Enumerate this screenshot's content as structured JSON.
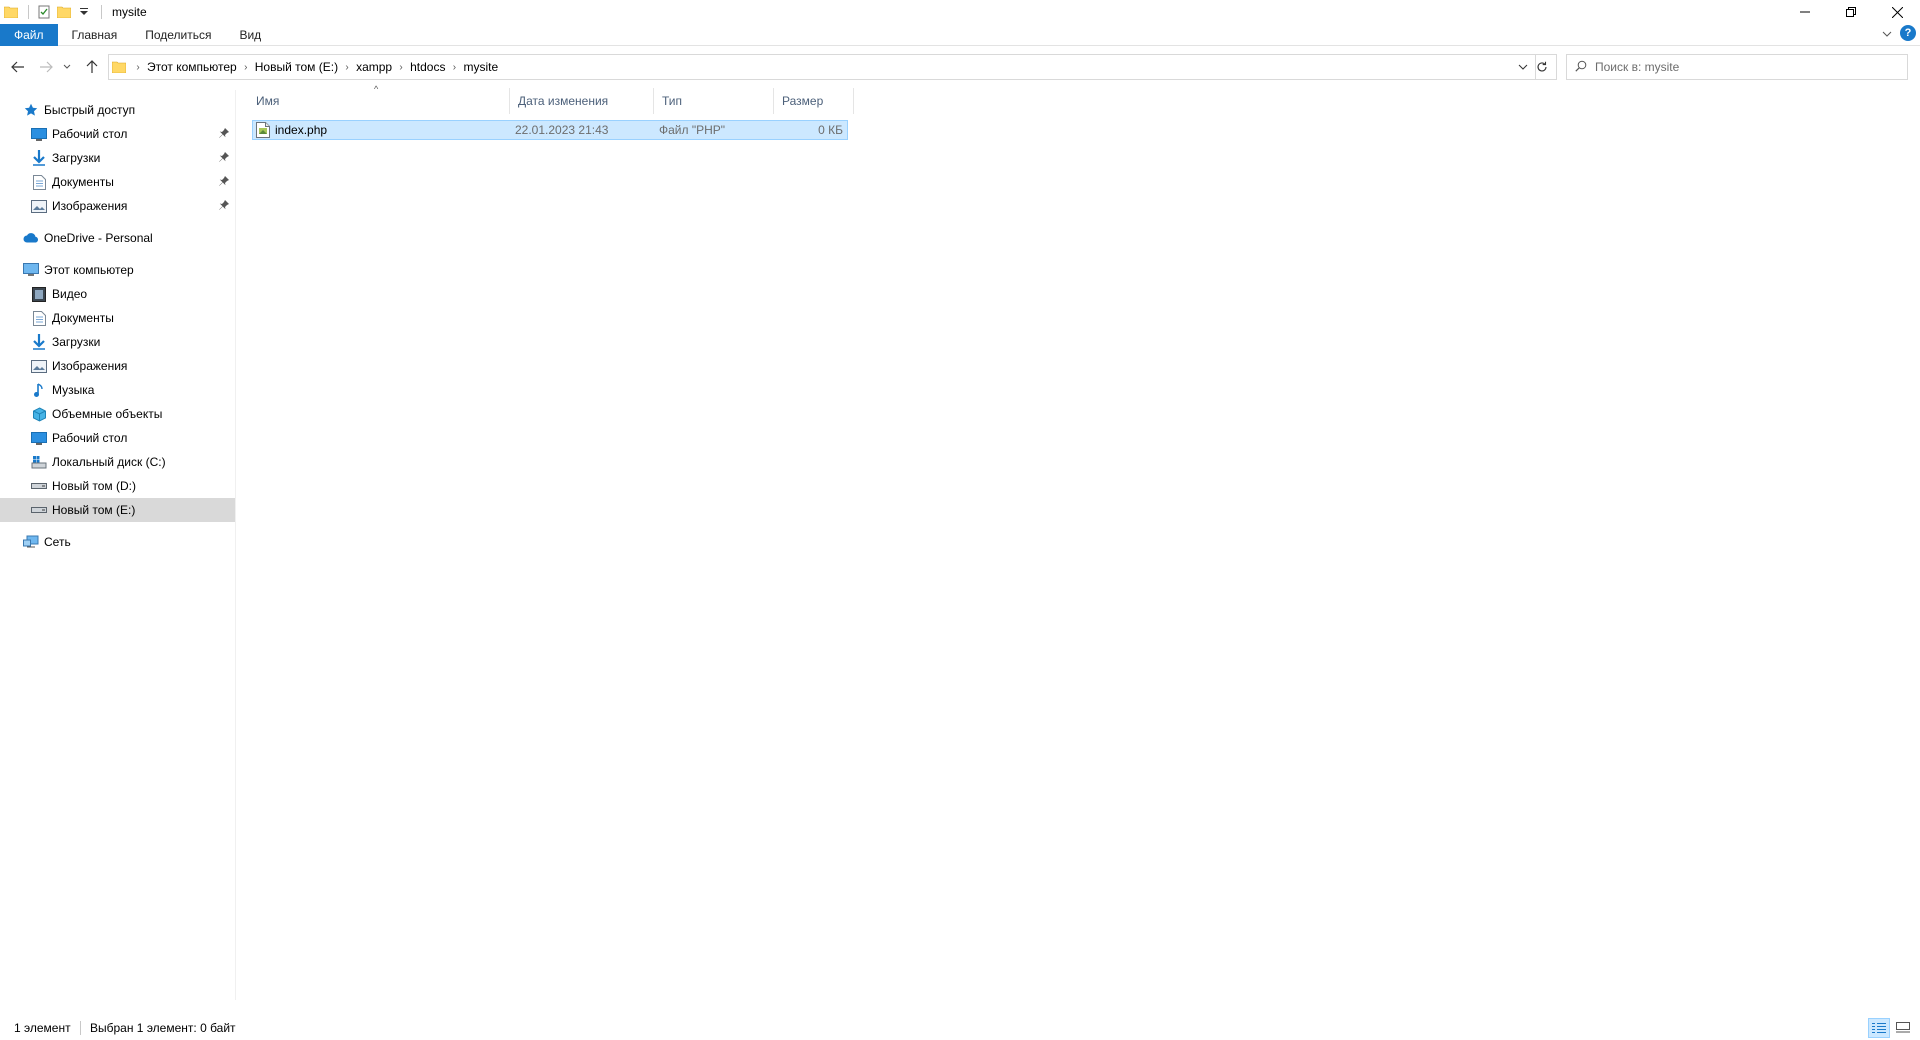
{
  "window": {
    "title": "mysite"
  },
  "ribbon": {
    "tabs": [
      "Файл",
      "Главная",
      "Поделиться",
      "Вид"
    ],
    "help_label": "?"
  },
  "address": {
    "crumbs": [
      "Этот компьютер",
      "Новый том (E:)",
      "xampp",
      "htdocs",
      "mysite"
    ]
  },
  "search": {
    "placeholder": "Поиск в: mysite"
  },
  "sidebar": {
    "quick_access": {
      "label": "Быстрый доступ",
      "items": [
        {
          "label": "Рабочий стол",
          "icon": "desktop-icon",
          "pinned": true
        },
        {
          "label": "Загрузки",
          "icon": "downloads-icon",
          "pinned": true
        },
        {
          "label": "Документы",
          "icon": "documents-icon",
          "pinned": true
        },
        {
          "label": "Изображения",
          "icon": "pictures-icon",
          "pinned": true
        }
      ]
    },
    "onedrive": {
      "label": "OneDrive - Personal"
    },
    "this_pc": {
      "label": "Этот компьютер",
      "items": [
        {
          "label": "Видео",
          "icon": "video-icon"
        },
        {
          "label": "Документы",
          "icon": "documents-icon"
        },
        {
          "label": "Загрузки",
          "icon": "downloads-icon"
        },
        {
          "label": "Изображения",
          "icon": "pictures-icon"
        },
        {
          "label": "Музыка",
          "icon": "music-icon"
        },
        {
          "label": "Объемные объекты",
          "icon": "3d-objects-icon"
        },
        {
          "label": "Рабочий стол",
          "icon": "desktop-icon"
        },
        {
          "label": "Локальный диск (C:)",
          "icon": "system-drive-icon"
        },
        {
          "label": "Новый том (D:)",
          "icon": "drive-icon"
        },
        {
          "label": "Новый том (E:)",
          "icon": "drive-icon",
          "selected": true
        }
      ]
    },
    "network": {
      "label": "Сеть"
    }
  },
  "filelist": {
    "columns": {
      "name": "Имя",
      "date": "Дата изменения",
      "type": "Тип",
      "size": "Размер"
    },
    "files": [
      {
        "name": "index.php",
        "date": "22.01.2023 21:43",
        "type": "Файл \"PHP\"",
        "size": "0 КБ",
        "selected": true
      }
    ]
  },
  "status": {
    "count": "1 элемент",
    "selection": "Выбран 1 элемент: 0 байт"
  },
  "colors": {
    "accent": "#1979ca",
    "selection": "#cce8ff",
    "selection_border": "#99d1ff",
    "sidebar_selected": "#d9d9d9"
  }
}
